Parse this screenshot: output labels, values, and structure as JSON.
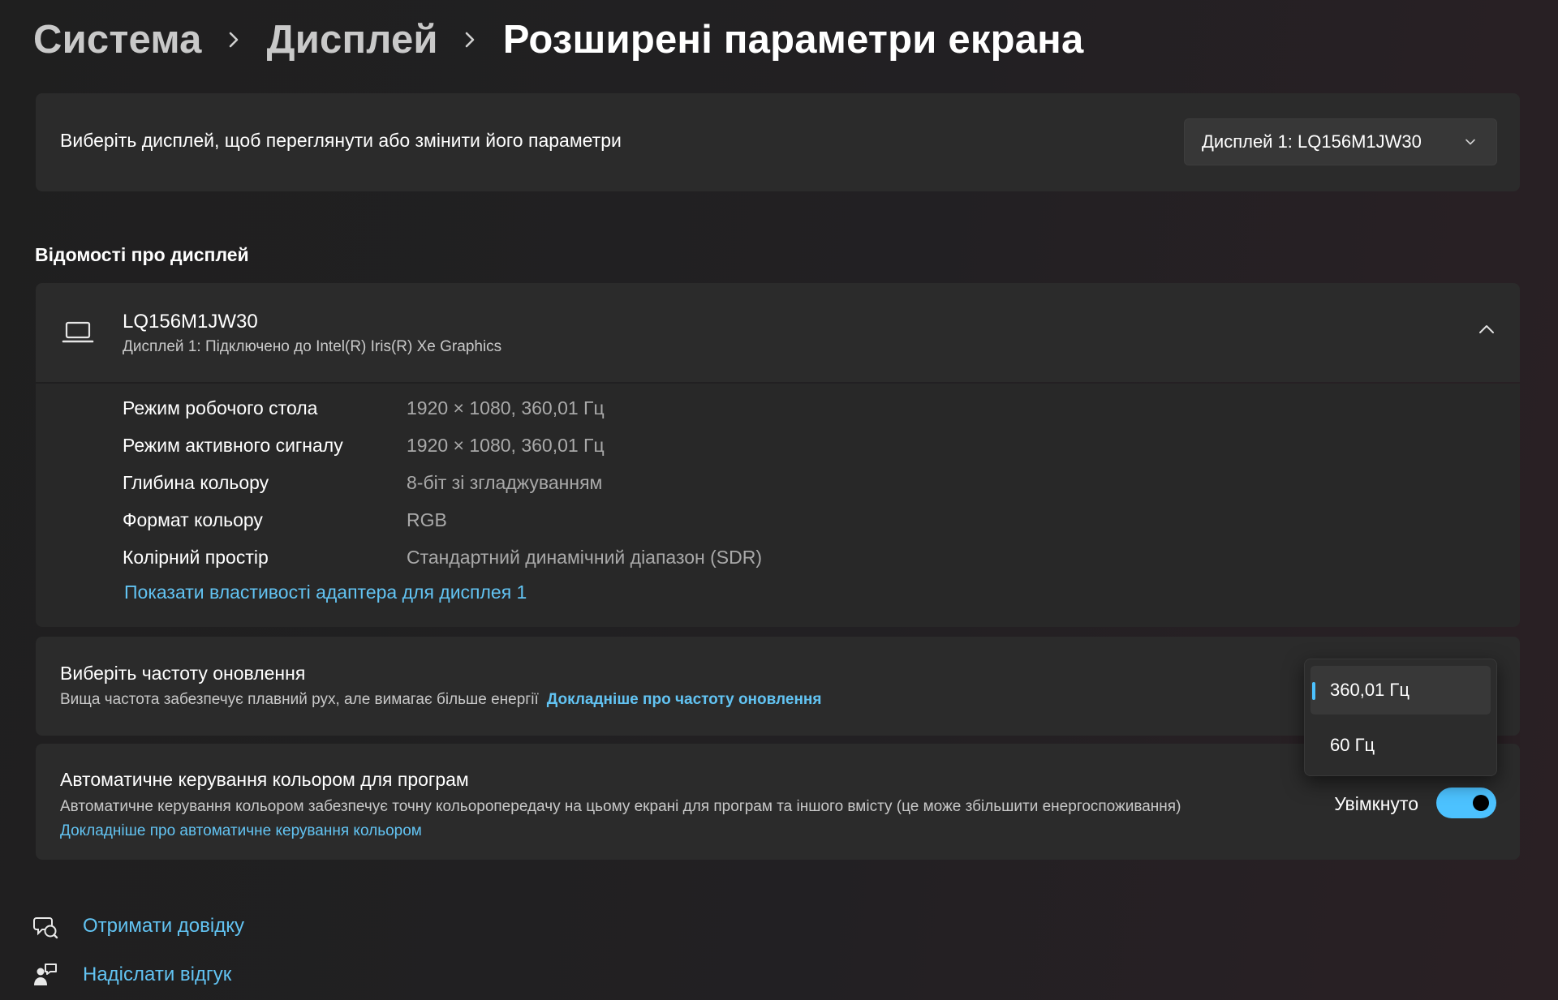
{
  "breadcrumb": {
    "items": [
      "Система",
      "Дисплей"
    ],
    "current": "Розширені параметри екрана"
  },
  "select_display": {
    "label": "Виберіть дисплей, щоб переглянути або змінити його параметри",
    "dropdown_value": "Дисплей 1: LQ156M1JW30"
  },
  "section_title": "Відомості про дисплей",
  "display_info": {
    "name": "LQ156M1JW30",
    "subtitle": "Дисплей 1: Підключено до Intel(R) Iris(R) Xe Graphics",
    "properties": [
      {
        "label": "Режим робочого стола",
        "value": "1920 × 1080, 360,01 Гц"
      },
      {
        "label": "Режим активного сигналу",
        "value": "1920 × 1080, 360,01 Гц"
      },
      {
        "label": "Глибина кольору",
        "value": "8-біт зі згладжуванням"
      },
      {
        "label": "Формат кольору",
        "value": "RGB"
      },
      {
        "label": "Колірний простір",
        "value": "Стандартний динамічний діапазон (SDR)"
      }
    ],
    "adapter_link": "Показати властивості адаптера для дисплея 1"
  },
  "refresh_rate": {
    "title": "Виберіть частоту оновлення",
    "description": "Вища частота забезпечує плавний рух, але вимагає більше енергії",
    "link": "Докладніше про частоту оновлення",
    "options": [
      "360,01 Гц",
      "60 Гц"
    ],
    "selected": "360,01 Гц"
  },
  "auto_color": {
    "title": "Автоматичне керування кольором для програм",
    "description": "Автоматичне керування кольором забезпечує точну кольоропередачу на цьому екрані для програм та іншого вмісту (це може збільшити енергоспоживання)",
    "link": "Докладніше про автоматичне керування кольором",
    "toggle_label": "Увімкнуто",
    "toggle_on": true
  },
  "footer_links": {
    "help": "Отримати довідку",
    "feedback": "Надіслати відгук"
  },
  "colors": {
    "accent": "#4cc2ff",
    "link": "#62c3f2",
    "card": "#2b2b2b",
    "background": "#202020"
  }
}
